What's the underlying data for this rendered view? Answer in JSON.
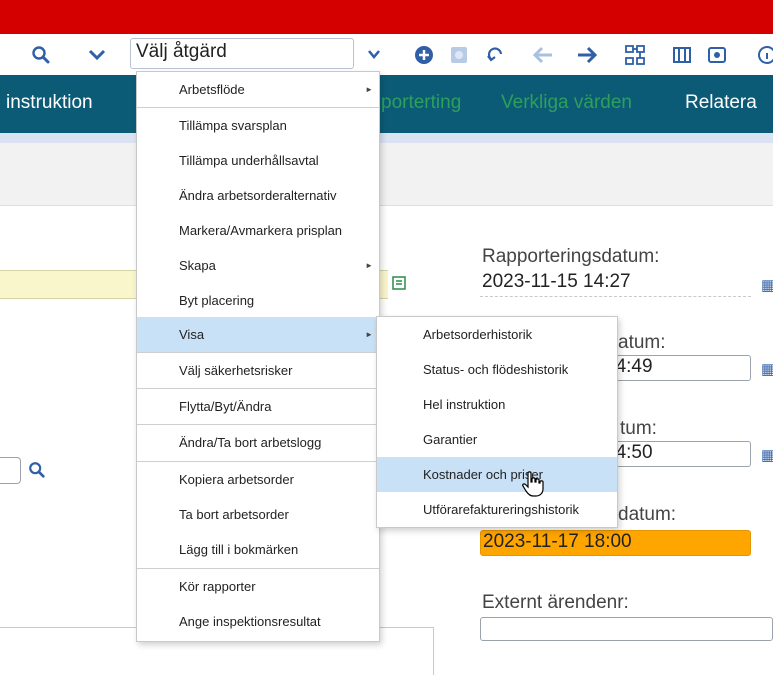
{
  "toolbar": {
    "action_select_value": "Välj åtgärd",
    "icons": [
      "search-icon",
      "chevron-down-icon",
      "select-chevron-icon",
      "add-icon",
      "disabled-icon",
      "undo-icon",
      "back-arrow-icon",
      "forward-arrow-icon",
      "workflow-icon",
      "map-icon",
      "view-icon",
      "info-icon"
    ]
  },
  "tabs": [
    {
      "label": "instruktion",
      "color": "#ffffff"
    },
    {
      "label": "porterting",
      "color": "#2ca05a"
    },
    {
      "label": "Verkliga värden",
      "color": "#2ca05a"
    },
    {
      "label": "Relatera",
      "color": "#ffffff"
    }
  ],
  "menu": {
    "items": [
      {
        "label": "Arbetsflöde",
        "submenu": true
      },
      {
        "label": "Tillämpa svarsplan"
      },
      {
        "label": "Tillämpa underhållsavtal"
      },
      {
        "label": "Ändra arbetsorderalternativ"
      },
      {
        "label": "Markera/Avmarkera prisplan"
      },
      {
        "label": "Skapa",
        "submenu": true
      },
      {
        "label": "Byt placering"
      },
      {
        "label": "Visa",
        "submenu": true,
        "highlighted": true
      },
      {
        "label": "Välj säkerhetsrisker"
      },
      {
        "label": "Flytta/Byt/Ändra"
      },
      {
        "label": "Ändra/Ta bort arbetslogg"
      },
      {
        "label": "Kopiera arbetsorder"
      },
      {
        "label": "Ta bort arbetsorder"
      },
      {
        "label": "Lägg till i bokmärken"
      },
      {
        "label": "Kör rapporter"
      },
      {
        "label": "Ange inspektionsresultat"
      }
    ],
    "arrow_glyph": "►"
  },
  "submenu": {
    "items": [
      {
        "label": "Arbetsorderhistorik"
      },
      {
        "label": "Status- och flödeshistorik"
      },
      {
        "label": "Hel instruktion"
      },
      {
        "label": "Garantier"
      },
      {
        "label": "Kostnader och priser",
        "highlighted": true
      },
      {
        "label": "Utförarefaktureringshistorik"
      }
    ]
  },
  "form": {
    "rapporteringsdatum_label": "Rapporteringsdatum:",
    "rapporteringsdatum_value": "2023-11-15 14:27",
    "date2_label_fragment": "atum:",
    "date2_value_fragment": "14:49",
    "date3_label_fragment": "tum:",
    "date3_value_fragment": "14:50",
    "date4_label_fragment": "datum:",
    "date4_value": "2023-11-17 18:00",
    "externt_label": "Externt ärendenr:",
    "externt_value": ""
  },
  "colors": {
    "red_bar": "#d40000",
    "tab_bar": "#0c5b76",
    "menu_highlight": "#c8e1f7",
    "overdue_field": "#ffa500",
    "yellow_field": "#faf6cc",
    "icon_blue": "#2f5fa7"
  }
}
